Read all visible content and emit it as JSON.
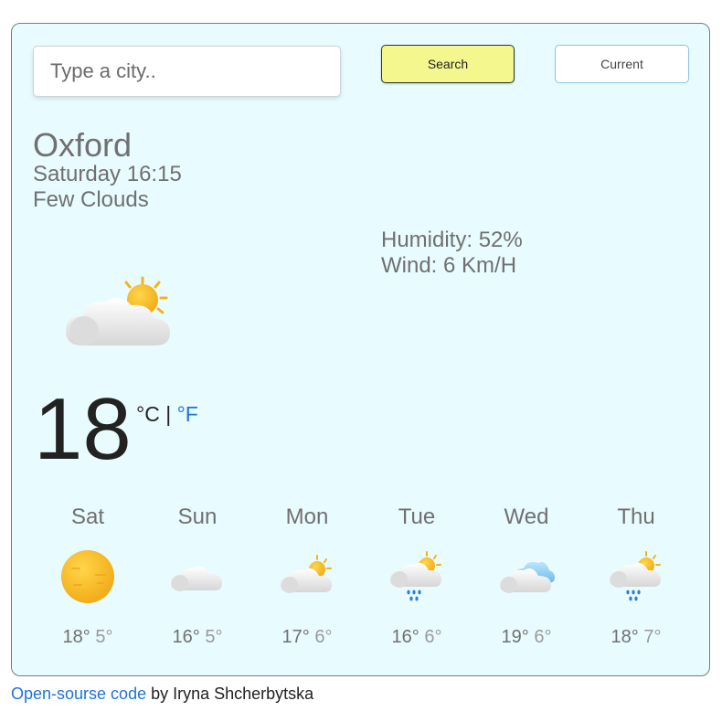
{
  "search": {
    "placeholder": "Type a city.."
  },
  "buttons": {
    "search_label": "Search",
    "current_label": "Current"
  },
  "weather": {
    "city": "Oxford",
    "datetime": "Saturday 16:15",
    "description": "Few Clouds",
    "humidity": "Humidity: 52%",
    "wind": "Wind: 6 Km/H",
    "icon": "few-clouds-icon",
    "temperature": "18",
    "unit_c": "°C",
    "separator": " | ",
    "unit_f": "°F"
  },
  "forecast": [
    {
      "day": "Sat",
      "max": "18°",
      "min": "5°",
      "icon": "clear-sun-icon"
    },
    {
      "day": "Sun",
      "max": "16°",
      "min": "5°",
      "icon": "cloud-icon"
    },
    {
      "day": "Mon",
      "max": "17°",
      "min": "6°",
      "icon": "few-clouds-icon"
    },
    {
      "day": "Tue",
      "max": "16°",
      "min": "6°",
      "icon": "sun-rain-icon"
    },
    {
      "day": "Wed",
      "max": "19°",
      "min": "6°",
      "icon": "blue-clouds-icon"
    },
    {
      "day": "Thu",
      "max": "18°",
      "min": "7°",
      "icon": "sun-rain-icon"
    }
  ],
  "footer": {
    "link_text": "Open-sourse code",
    "author_text": " by Iryna Shcherbytska"
  },
  "colors": {
    "card_bg": "#e8fbfe",
    "search_btn": "#f4f68e",
    "link": "#1e74d6",
    "sun": "#f2b41a"
  }
}
